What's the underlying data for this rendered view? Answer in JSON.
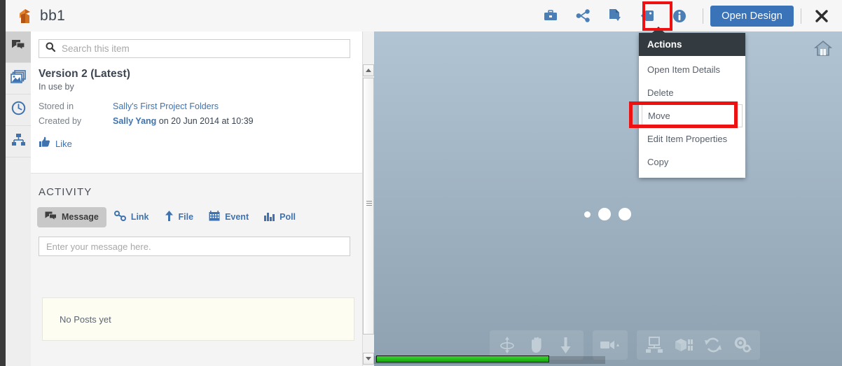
{
  "window": {
    "title": "bb1",
    "logo": "autodesk-logo"
  },
  "topbar": {
    "icons": [
      {
        "name": "briefcase-icon",
        "label": "Briefcase"
      },
      {
        "name": "share-icon",
        "label": "Share"
      },
      {
        "name": "actions-icon",
        "label": "Actions"
      },
      {
        "name": "tag-icon",
        "label": "Tag"
      },
      {
        "name": "info-icon",
        "label": "Info"
      }
    ],
    "open_design_label": "Open Design",
    "close_label": "✕"
  },
  "rail": {
    "items": [
      {
        "name": "sidebar-item-activity",
        "icon": "chat-icon",
        "active": true
      },
      {
        "name": "sidebar-item-gallery",
        "icon": "images-icon",
        "active": false
      },
      {
        "name": "sidebar-item-versions",
        "icon": "clock-icon",
        "active": false
      },
      {
        "name": "sidebar-item-structure",
        "icon": "hierarchy-icon",
        "active": false
      }
    ]
  },
  "panel": {
    "search": {
      "placeholder": "Search this item",
      "value": "",
      "icon": "search-icon"
    },
    "version_title": "Version 2 (Latest)",
    "in_use_by_label": "In use by",
    "in_use_by_value": "",
    "meta": [
      {
        "label": "Stored in",
        "value": "Sally's First Project Folders",
        "link": true,
        "bold": false
      },
      {
        "label": "Created by",
        "value": "Sally Yang",
        "link": true,
        "bold": true,
        "suffix": " on 20 Jun 2014 at 10:39"
      }
    ],
    "like_label": "Like",
    "like_icon": "thumbs-up-icon",
    "activity_title": "ACTIVITY",
    "tabs": [
      {
        "label": "Message",
        "icon": "message-icon",
        "active": true
      },
      {
        "label": "Link",
        "icon": "link-icon",
        "active": false
      },
      {
        "label": "File",
        "icon": "upload-arrow-icon",
        "active": false
      },
      {
        "label": "Event",
        "icon": "calendar-icon",
        "active": false
      },
      {
        "label": "Poll",
        "icon": "bar-chart-icon",
        "active": false
      }
    ],
    "message_placeholder": "Enter your message here.",
    "message_value": "",
    "no_posts_text": "No Posts yet"
  },
  "actions_menu": {
    "header": "Actions",
    "items": [
      {
        "label": "Open Item Details",
        "hovered": false
      },
      {
        "label": "Delete",
        "hovered": false
      },
      {
        "label": "Move",
        "hovered": true
      },
      {
        "label": "Edit Item Properties",
        "hovered": false
      },
      {
        "label": "Copy",
        "hovered": false
      }
    ]
  },
  "viewport": {
    "home_icon": "home-icon",
    "dots": [
      "small",
      "big",
      "big"
    ],
    "toolbar_groups": [
      {
        "buttons": [
          {
            "name": "orbit-icon"
          },
          {
            "name": "pan-hand-icon"
          },
          {
            "name": "zoom-arrow-icon"
          }
        ]
      },
      {
        "buttons": [
          {
            "name": "camera-icon"
          }
        ]
      },
      {
        "buttons": [
          {
            "name": "display-monitor-icon"
          },
          {
            "name": "cube-model-icon"
          },
          {
            "name": "refresh-sync-icon"
          },
          {
            "name": "settings-gears-icon"
          }
        ]
      }
    ],
    "progress_percent": 74
  },
  "annotations": {
    "highlight_color": "#ee1111",
    "boxes": [
      "actions-icon-highlight",
      "move-menu-item-highlight"
    ]
  },
  "colors": {
    "accent_blue": "#3b73b9",
    "link_blue": "#3f73b0",
    "menu_header": "#333a40",
    "progress_green": "#2fc129"
  }
}
